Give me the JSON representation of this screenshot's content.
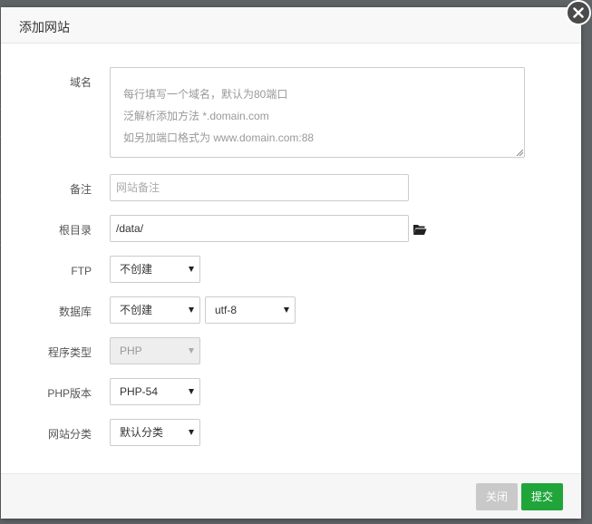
{
  "dialog": {
    "title": "添加网站"
  },
  "form": {
    "domain": {
      "label": "域名",
      "placeholder_lines": [
        "每行填写一个域名，默认为80端口",
        "泛解析添加方法 *.domain.com",
        "如另加端口格式为 www.domain.com:88"
      ]
    },
    "remark": {
      "label": "备注",
      "placeholder": "网站备注"
    },
    "root_dir": {
      "label": "根目录",
      "value": "/data/"
    },
    "ftp": {
      "label": "FTP",
      "selected": "不创建"
    },
    "database": {
      "label": "数据库",
      "selected": "不创建",
      "charset": "utf-8"
    },
    "program_type": {
      "label": "程序类型",
      "selected": "PHP"
    },
    "php_version": {
      "label": "PHP版本",
      "selected": "PHP-54"
    },
    "site_category": {
      "label": "网站分类",
      "selected": "默认分类"
    }
  },
  "footer": {
    "close_label": "关闭",
    "submit_label": "提交"
  },
  "colors": {
    "submit": "#20a53a",
    "close": "#c9c9c9",
    "overlay": "#5e6365"
  }
}
